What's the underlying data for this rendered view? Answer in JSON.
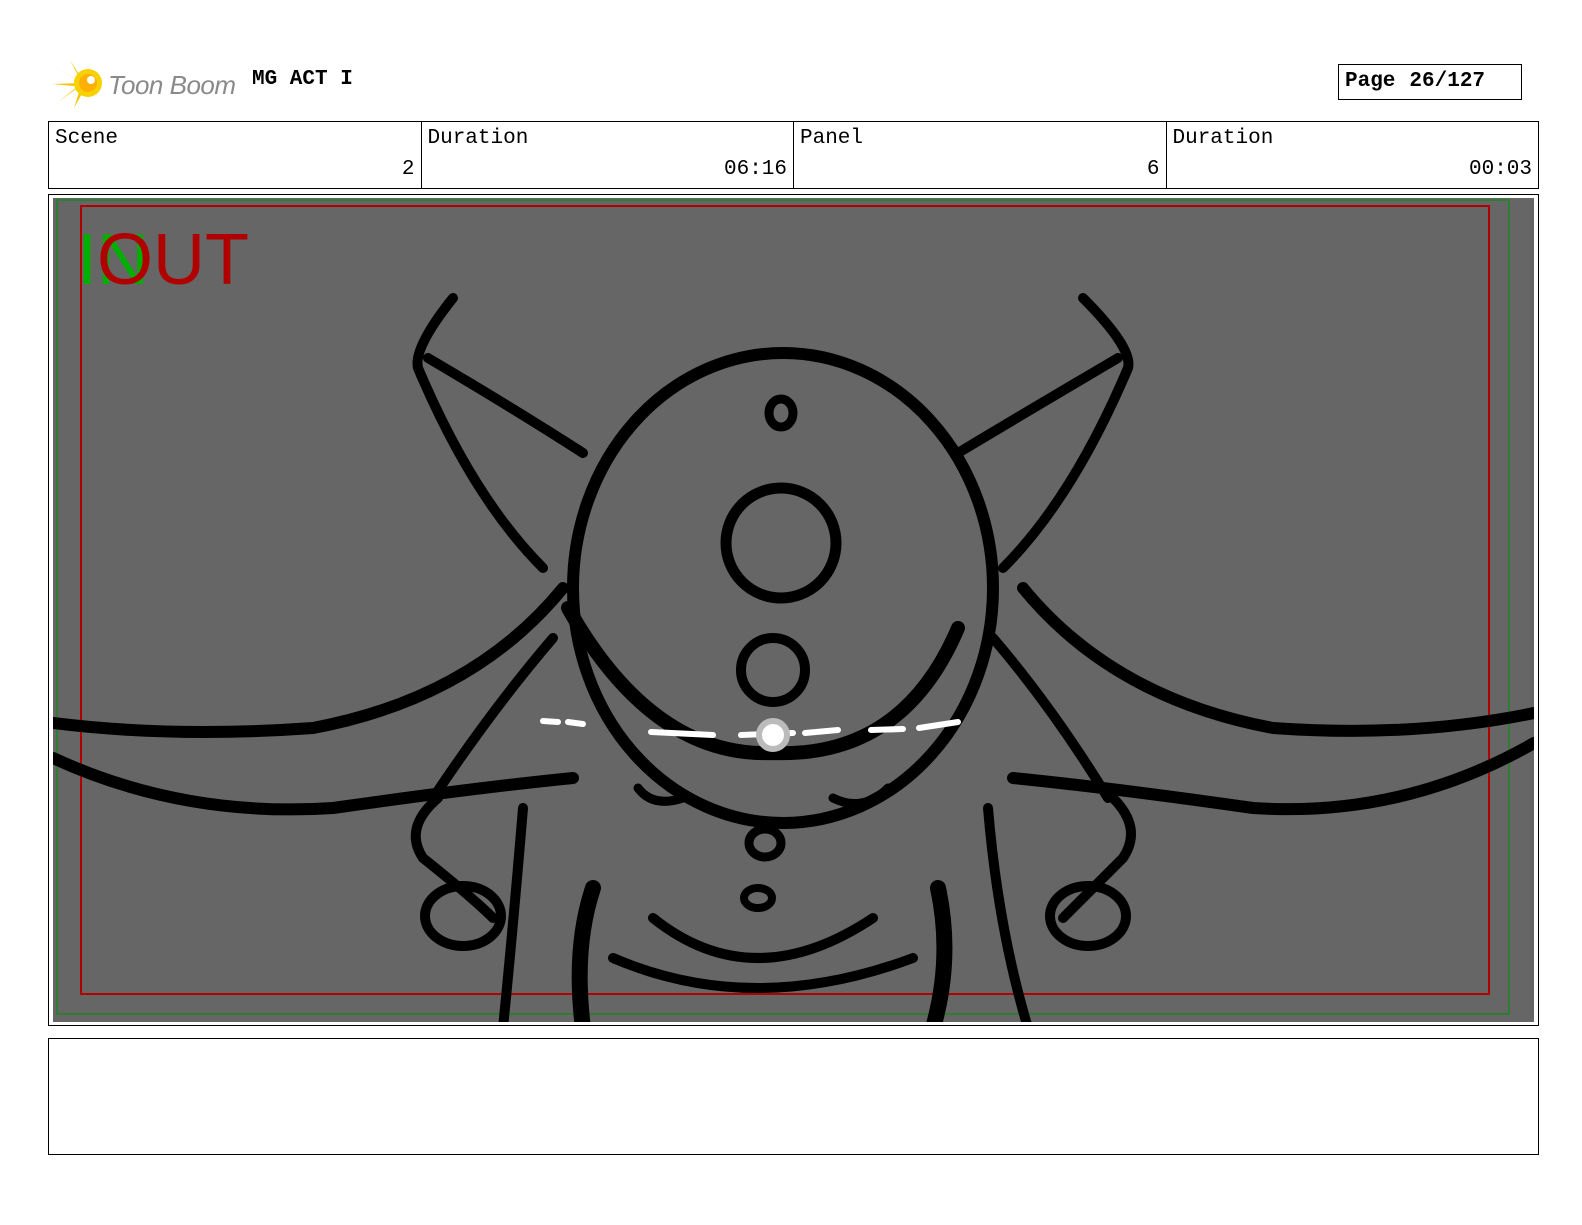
{
  "header": {
    "logo_text": "Toon Boom",
    "project_title": "MG ACT I",
    "page_label": "Page",
    "page_number": "26/127"
  },
  "info": {
    "scene_label": "Scene",
    "scene_value": "2",
    "scene_duration_label": "Duration",
    "scene_duration_value": "06:16",
    "panel_label": "Panel",
    "panel_value": "6",
    "panel_duration_label": "Duration",
    "panel_duration_value": "00:03"
  },
  "panel": {
    "in_label": "IN",
    "out_label": "OUT",
    "background_color": "#666666",
    "safe_frame_color": "#b00000",
    "camera_frame_color": "#2e7d32"
  },
  "notes": {
    "text": ""
  }
}
